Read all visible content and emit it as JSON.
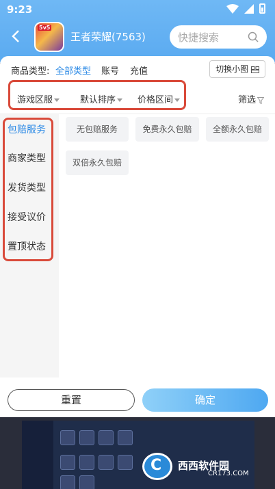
{
  "status": {
    "time": "9:23"
  },
  "header": {
    "title": "王者荣耀(7563)",
    "search_placeholder": "快捷搜索",
    "logo_badge": "5v5"
  },
  "type_row": {
    "label": "商品类型:",
    "options": [
      "全部类型",
      "账号",
      "充值"
    ],
    "active_index": 0,
    "switch_label": "切换小图"
  },
  "filters": {
    "items": [
      "游戏区服",
      "默认排序",
      "价格区间"
    ],
    "filter_label": "筛选"
  },
  "side_nav": {
    "items": [
      "包赔服务",
      "商家类型",
      "发货类型",
      "接受议价",
      "置顶状态"
    ],
    "active_index": 0
  },
  "tags": [
    "无包赔服务",
    "免费永久包赔",
    "全额永久包赔",
    "双倍永久包赔"
  ],
  "footer": {
    "reset_label": "重置",
    "confirm_label": "确定"
  },
  "watermark": {
    "text": "西西软件园",
    "sub": "CR173.COM",
    "logo_letter": "C"
  },
  "colors": {
    "accent": "#2e8be6",
    "highlight_box": "#d94a3a",
    "header_blue": "#5aaaf0"
  }
}
